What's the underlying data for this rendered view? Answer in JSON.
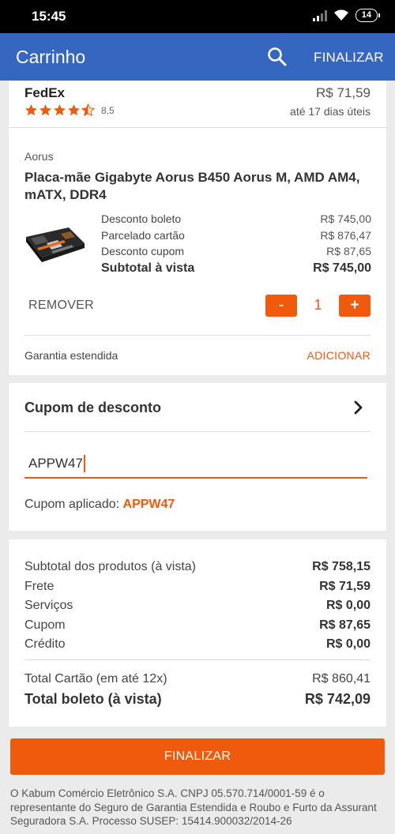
{
  "status_bar": {
    "time": "15:45",
    "battery": "14"
  },
  "app_bar": {
    "title": "Carrinho",
    "finalizar_label": "FINALIZAR"
  },
  "shipping": {
    "carrier": "FedEx",
    "rating": "8,5",
    "price": "R$ 71,59",
    "eta": "até 17 dias úteis",
    "stars": 4.5
  },
  "product": {
    "brand": "Aorus",
    "name": "Placa-mãe Gigabyte Aorus B450 Aorus M, AMD AM4, mATX, DDR4",
    "prices": [
      {
        "label": "Desconto boleto",
        "value": "R$ 745,00"
      },
      {
        "label": "Parcelado cartão",
        "value": "R$ 876,47"
      },
      {
        "label": "Desconto cupom",
        "value": "R$ 87,65"
      }
    ],
    "subtotal_label": "Subtotal à vista",
    "subtotal_value": "R$ 745,00",
    "remove_label": "REMOVER",
    "qty_minus": "-",
    "qty_plus": "+",
    "quantity": "1",
    "warranty_label": "Garantia estendida",
    "warranty_action": "ADICIONAR"
  },
  "coupon": {
    "title": "Cupom de desconto",
    "input_value": "APPW47",
    "applied_label": "Cupom aplicado:",
    "applied_code": "APPW47"
  },
  "summary": {
    "rows": [
      {
        "label": "Subtotal dos produtos (à vista)",
        "value": "R$ 758,15"
      },
      {
        "label": "Frete",
        "value": "R$ 71,59"
      },
      {
        "label": "Serviços",
        "value": "R$ 0,00"
      },
      {
        "label": "Cupom",
        "value": "R$ 87,65"
      },
      {
        "label": "Crédito",
        "value": "R$ 0,00"
      }
    ],
    "card_total_label": "Total Cartão (em até 12x)",
    "card_total_value": "R$ 860,41",
    "boleto_total_label": "Total boleto (à vista)",
    "boleto_total_value": "R$ 742,09"
  },
  "finalizar_button": "FINALIZAR",
  "legal_text": "O Kabum Comércio Eletrônico S.A. CNPJ 05.570.714/0001-59 é o representante do Seguro de Garantia Estendida e Roubo e Furto da Assurant Seguradora S.A. Processo SUSEP: 15414.900032/2014-26",
  "colors": {
    "app_bar": "#3566c0",
    "accent": "#f05a0c",
    "star": "#f05a0c"
  }
}
